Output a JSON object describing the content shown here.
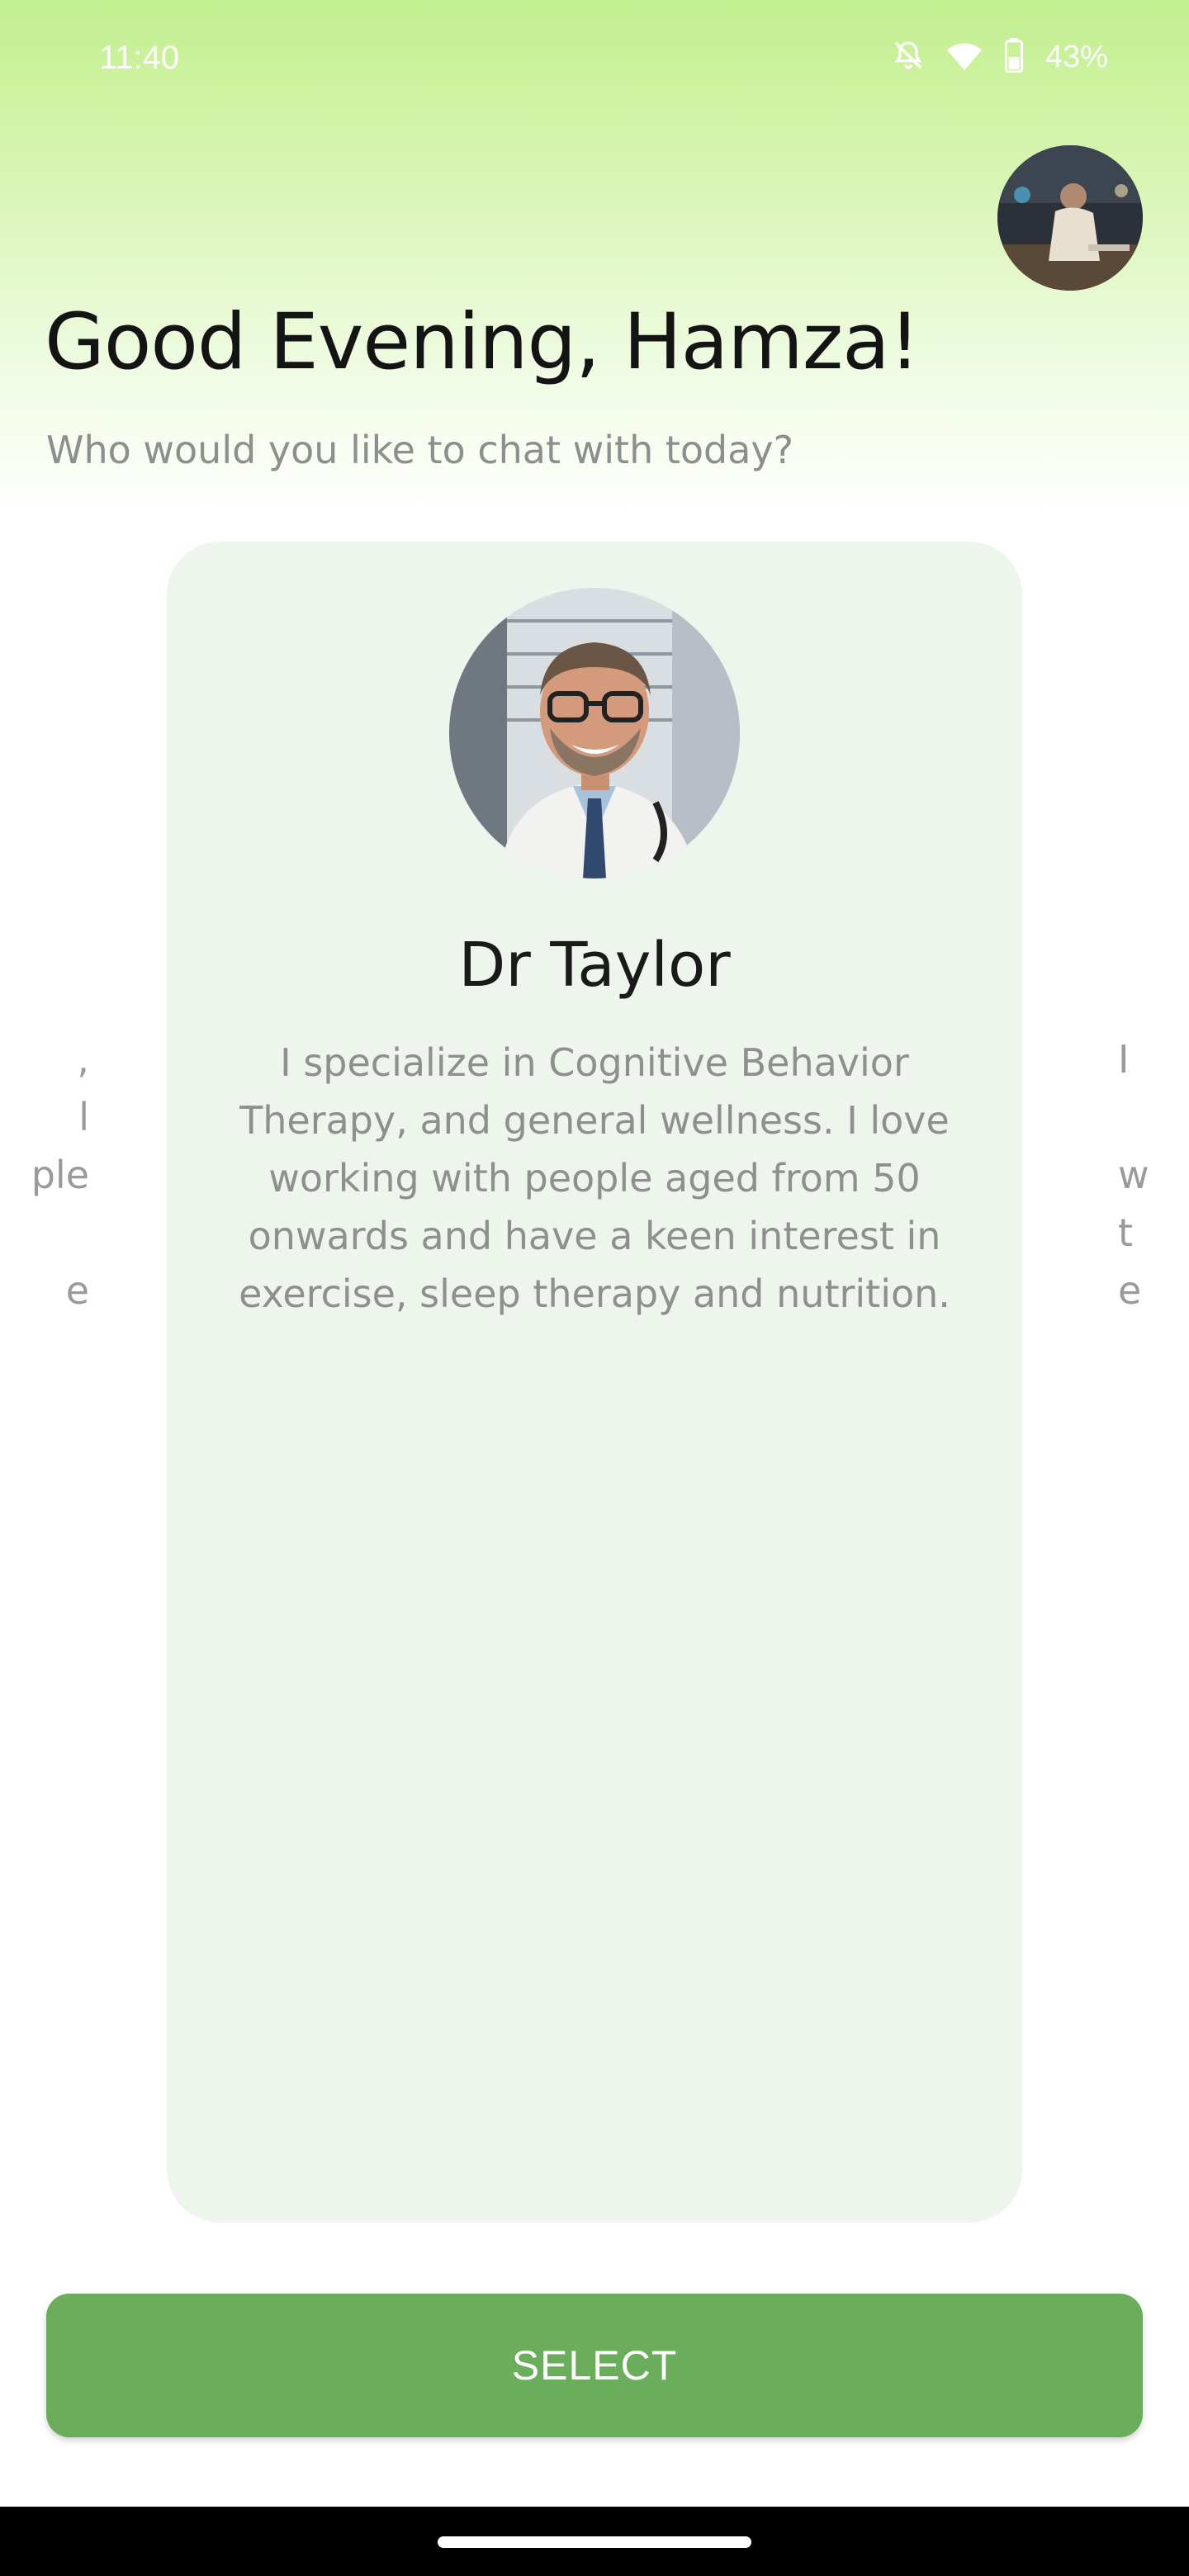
{
  "status_bar": {
    "time": "11:40",
    "battery": "43%",
    "icons": [
      "mute-icon",
      "wifi-icon",
      "battery-icon"
    ]
  },
  "header": {
    "greeting": "Good Evening, Hamza!",
    "subtitle": "Who would you like to chat with today?"
  },
  "carousel": {
    "left_card_fragments": [
      ",",
      "l",
      "ple",
      "",
      "e"
    ],
    "right_card_fragments": [
      "I",
      "",
      "w",
      "t",
      "e"
    ],
    "current": {
      "name": "Dr Taylor",
      "bio": "I specialize in Cognitive  Behavior Therapy, and  general wellness. I love  working with people aged from 50 onwards and have a  keen interest in exercise,  sleep therapy and nutrition."
    }
  },
  "actions": {
    "select_label": "SELECT"
  },
  "colors": {
    "accent": "#6aad5a",
    "card_bg": "#eef5ec",
    "gradient_top": "#c2ef8e"
  }
}
